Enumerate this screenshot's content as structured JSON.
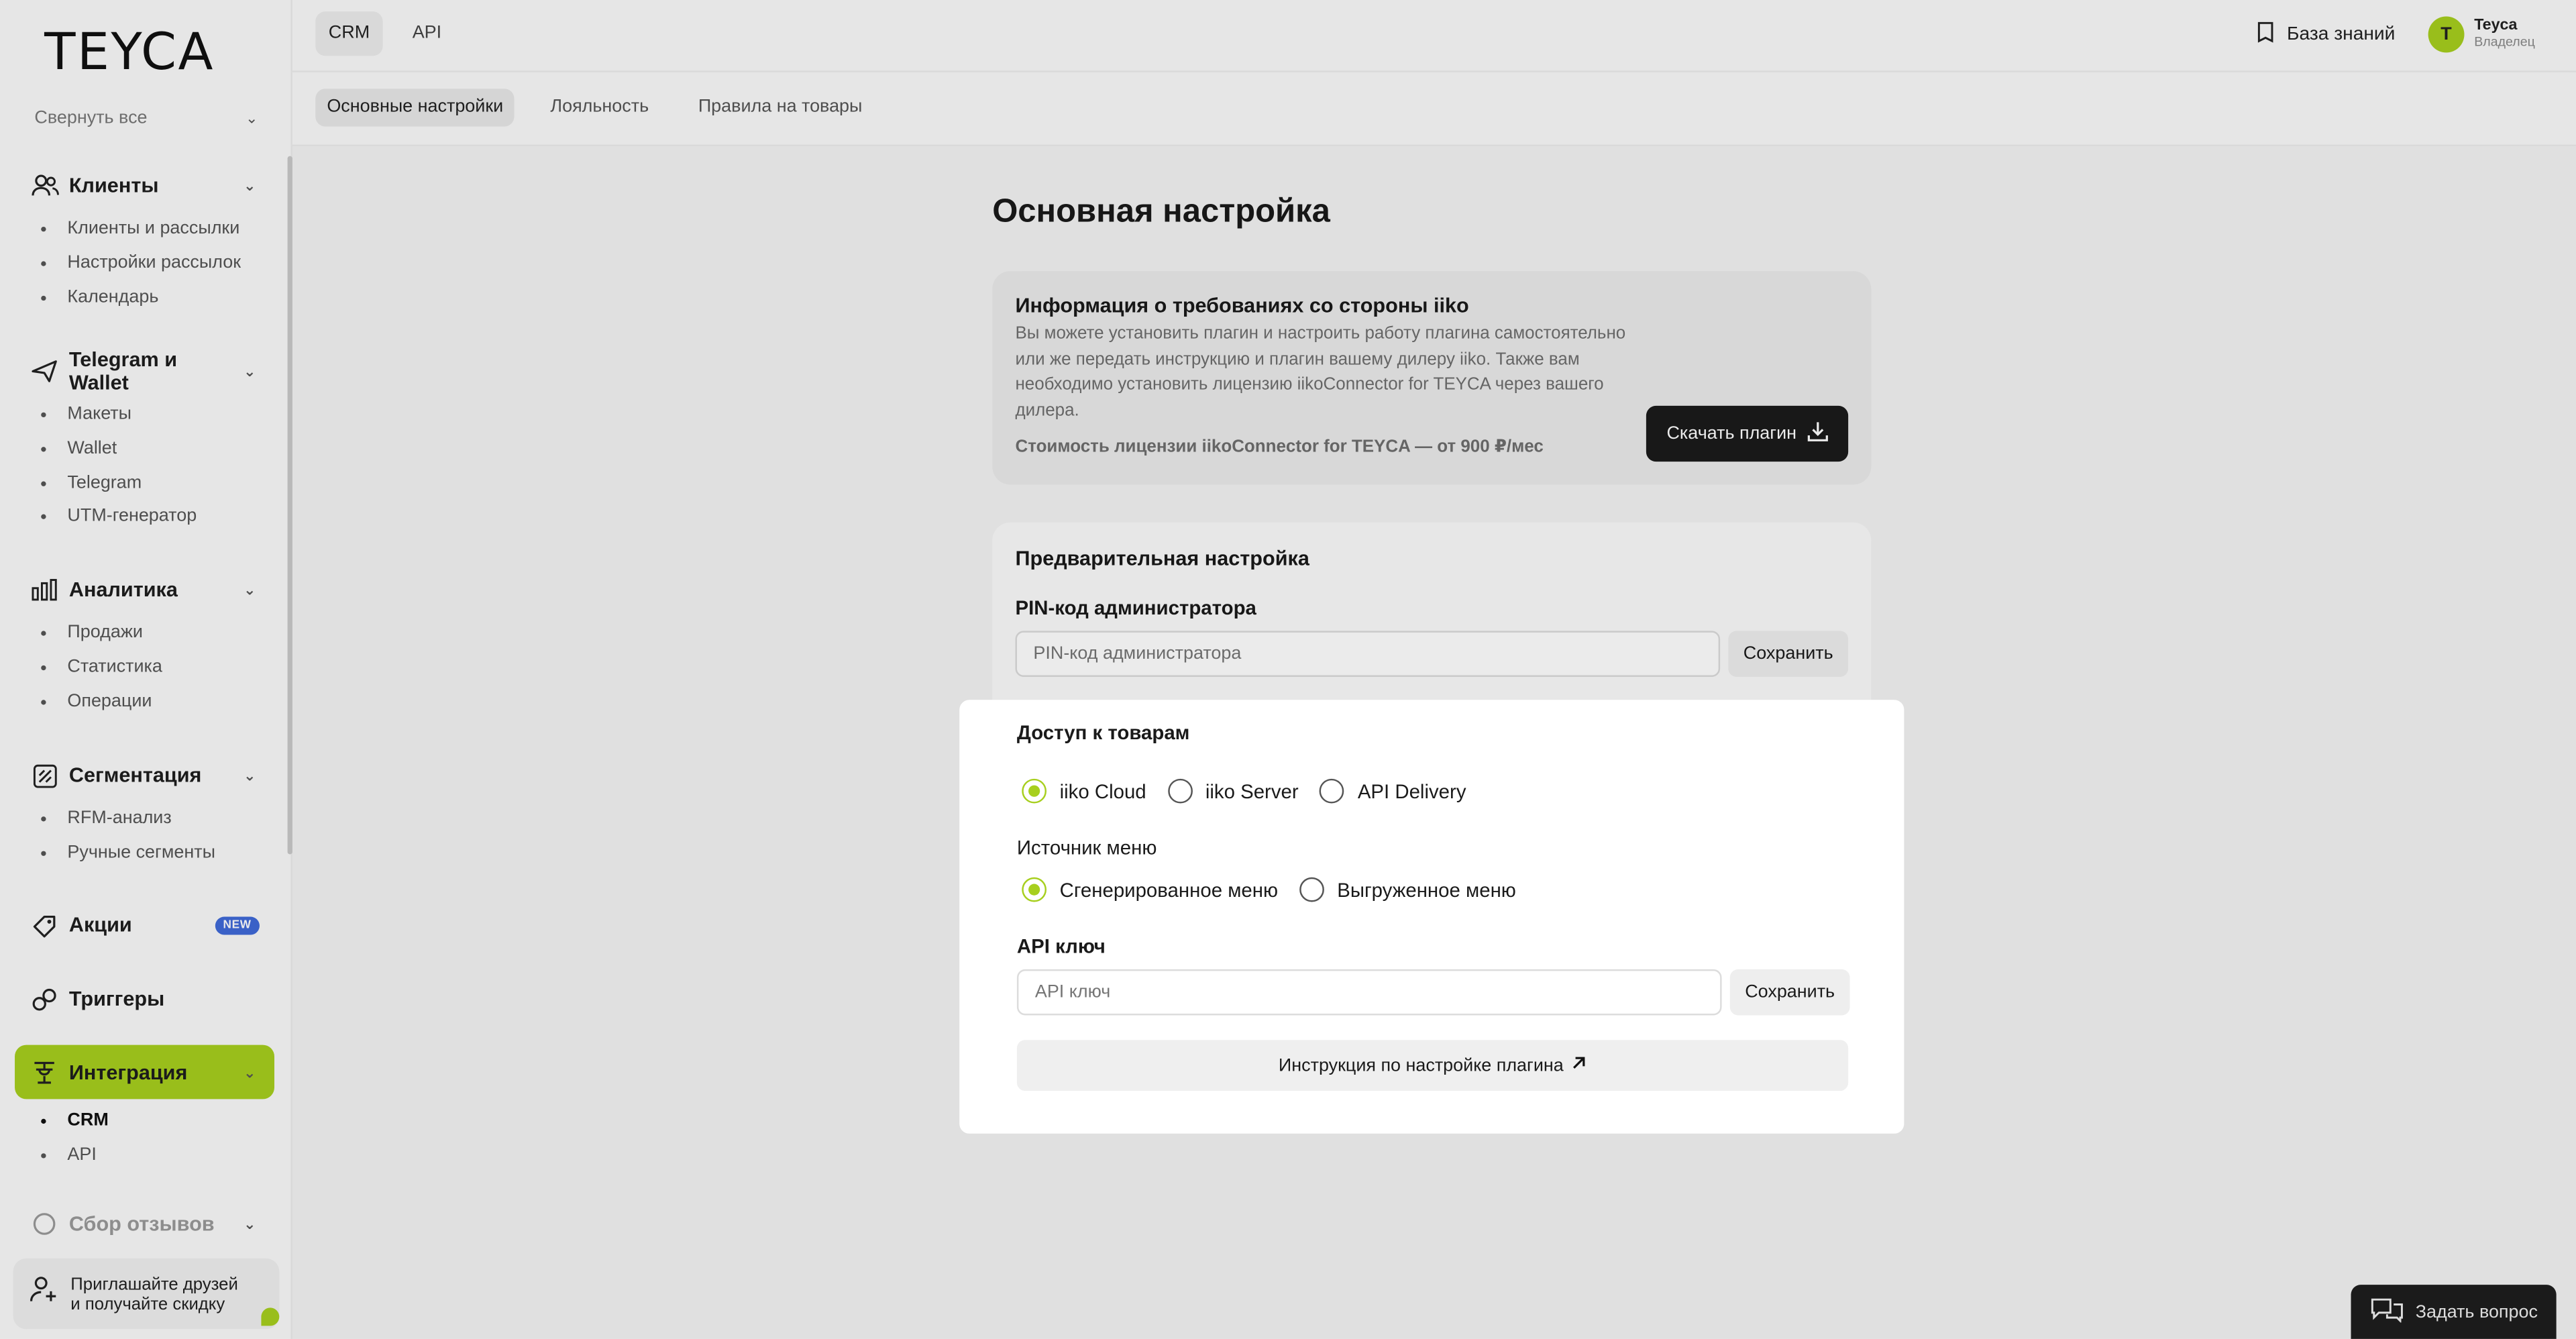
{
  "logo": "TEYCA",
  "sidebar": {
    "collapse_all": "Свернуть все",
    "sections": [
      {
        "label": "Клиенты",
        "items": [
          "Клиенты и рассылки",
          "Настройки рассылок",
          "Календарь"
        ]
      },
      {
        "label": "Telegram и Wallet",
        "items": [
          "Макеты",
          "Wallet",
          "Telegram",
          "UTM-генератор"
        ]
      },
      {
        "label": "Аналитика",
        "items": [
          "Продажи",
          "Статистика",
          "Операции"
        ]
      },
      {
        "label": "Сегментация",
        "items": [
          "RFM-анализ",
          "Ручные сегменты"
        ]
      }
    ],
    "promotions": {
      "label": "Акции",
      "badge": "NEW"
    },
    "triggers": {
      "label": "Триггеры"
    },
    "integration": {
      "label": "Интеграция",
      "items": [
        "CRM",
        "API"
      ]
    },
    "reviews": {
      "label": "Сбор отзывов"
    },
    "invite": {
      "line1": "Приглашайте друзей",
      "line2": "и получайте скидку"
    }
  },
  "topbar": {
    "tabs": [
      "CRM",
      "API"
    ],
    "knowledge_base": "База знаний",
    "user": {
      "initial": "T",
      "name": "Teyca",
      "role": "Владелец"
    }
  },
  "subtabs": [
    "Основные настройки",
    "Лояльность",
    "Правила на товары"
  ],
  "main": {
    "title": "Основная настройка",
    "info": {
      "title": "Информация о требованиях со стороны iiko",
      "text": "Вы можете установить плагин и настроить работу плагина самостоятельно или же передать инструкцию и плагин вашему дилеру iiko. Также вам необходимо установить лицензию iikoConnector for TEYCA через вашего дилера.",
      "price": "Стоимость лицензии iikoConnector for TEYCA — от 900 ₽/мес",
      "download_button": "Скачать плагин"
    },
    "pre": {
      "title": "Предварительная настройка",
      "pin_label": "PIN-код администратора",
      "pin_placeholder": "PIN-код администратора",
      "save": "Сохранить"
    },
    "access": {
      "title": "Доступ к товарам",
      "options": [
        "iiko Cloud",
        "iiko Server",
        "API Delivery"
      ],
      "selected": "iiko Cloud"
    },
    "menu_source": {
      "title": "Источник меню",
      "options": [
        "Сгенерированное меню",
        "Выгруженное меню"
      ],
      "selected": "Сгенерированное меню"
    },
    "api_key": {
      "label": "API ключ",
      "placeholder": "API ключ",
      "save": "Сохранить"
    },
    "instruction_button": "Инструкция по настройке плагина"
  },
  "ask_question": "Задать вопрос",
  "colors": {
    "accent": "#a7cf1e",
    "dark_button": "#1b1b1b",
    "badge": "#3f6ad8"
  }
}
